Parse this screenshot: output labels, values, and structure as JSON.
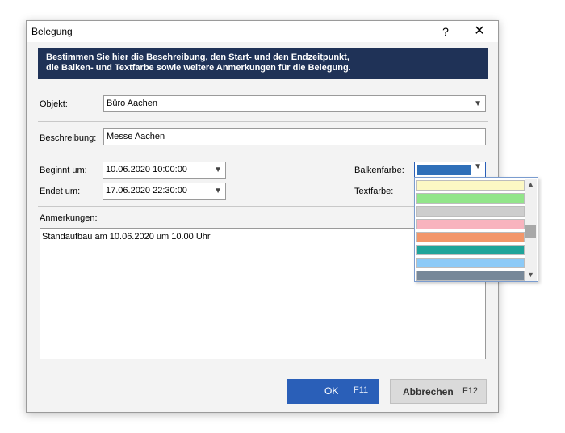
{
  "window": {
    "title": "Belegung",
    "help_label": "?",
    "close_label": "✕"
  },
  "banner": {
    "line1": "Bestimmen Sie hier die Beschreibung, den Start- und den Endzeitpunkt,",
    "line2": "die Balken- und Textfarbe sowie weitere Anmerkungen für die Belegung."
  },
  "objekt": {
    "label": "Objekt:",
    "value": "Büro Aachen"
  },
  "beschreibung": {
    "label": "Beschreibung:",
    "value": "Messe Aachen"
  },
  "beginnt": {
    "label": "Beginnt um:",
    "value": "10.06.2020 10:00:00"
  },
  "endet": {
    "label": "Endet um:",
    "value": "17.06.2020 22:30:00"
  },
  "balkenfarbe": {
    "label": "Balkenfarbe:",
    "selected_color": "#2f6fb8",
    "options": [
      "#fcf8c4",
      "#92e58a",
      "#cdcdcd",
      "#f8b3be",
      "#f2966a",
      "#1fa49a",
      "#8ccaf7",
      "#778899"
    ]
  },
  "textfarbe": {
    "label": "Textfarbe:"
  },
  "anmerkungen": {
    "label": "Anmerkungen:",
    "value": "Standaufbau am 10.06.2020 um 10.00 Uhr"
  },
  "buttons": {
    "ok_label": "OK",
    "ok_key": "F11",
    "cancel_label": "Abbrechen",
    "cancel_key": "F12"
  }
}
